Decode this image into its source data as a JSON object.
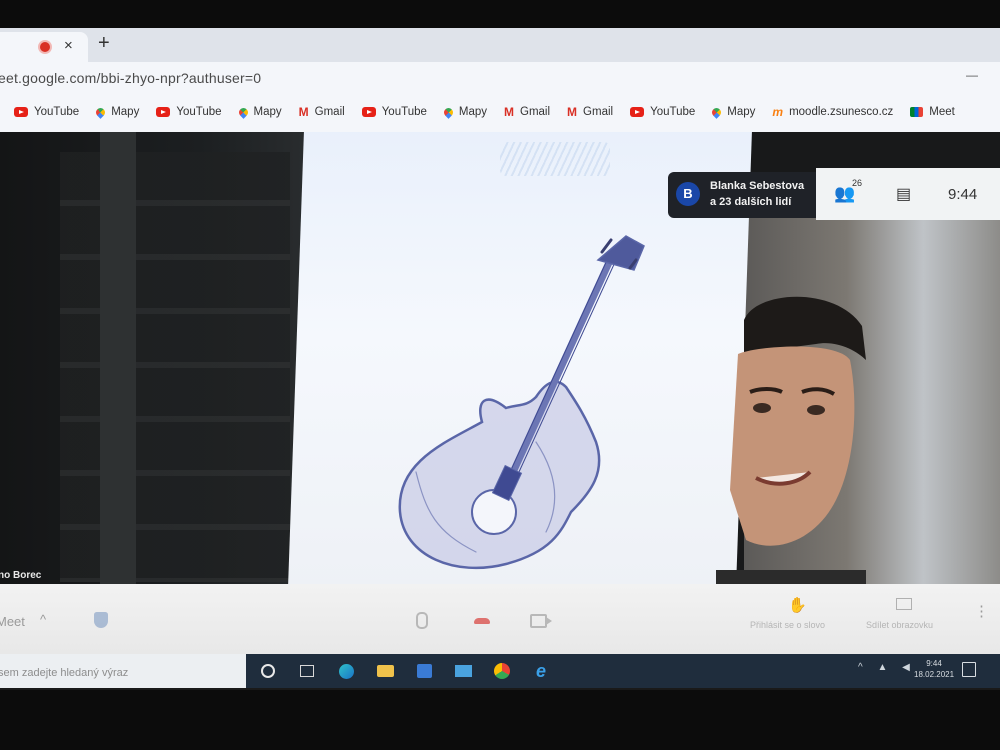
{
  "browser": {
    "tab_close": "×",
    "new_tab": "+",
    "url": "eet.google.com/bbi-zhyo-npr?authuser=0",
    "window_minimize": "—"
  },
  "bookmarks": [
    {
      "label": "YouTube",
      "icon": "youtube-icon"
    },
    {
      "label": "Mapy",
      "icon": "maps-icon"
    },
    {
      "label": "YouTube",
      "icon": "youtube-icon"
    },
    {
      "label": "Mapy",
      "icon": "maps-icon"
    },
    {
      "label": "Gmail",
      "icon": "gmail-icon"
    },
    {
      "label": "YouTube",
      "icon": "youtube-icon"
    },
    {
      "label": "Mapy",
      "icon": "maps-icon"
    },
    {
      "label": "Gmail",
      "icon": "gmail-icon"
    },
    {
      "label": "Gmail",
      "icon": "gmail-icon"
    },
    {
      "label": "YouTube",
      "icon": "youtube-icon"
    },
    {
      "label": "Mapy",
      "icon": "maps-icon"
    },
    {
      "label": "moodle.zsunesco.cz",
      "icon": "moodle-icon"
    },
    {
      "label": "Meet",
      "icon": "meet-icon"
    }
  ],
  "meet": {
    "participant_name": "no Borec",
    "people_card": {
      "avatar": "B",
      "name": "Blanka Sebestova",
      "more": "a 23 dalších lidí"
    },
    "participant_count": "26",
    "clock": "9:44",
    "meet_label": "Meet",
    "raise_hand_label": "Přihlásit se o slovo",
    "present_label": "Sdílet obrazovku"
  },
  "taskbar": {
    "search_placeholder": "sem zadejte hledaný výraz",
    "time": "9:44",
    "date": "18.02.2021"
  }
}
